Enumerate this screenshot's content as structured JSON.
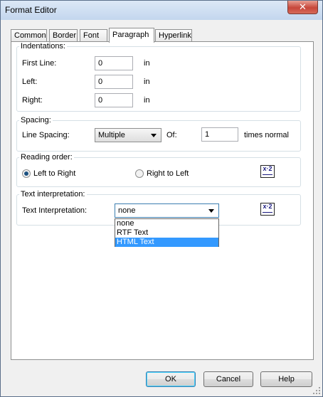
{
  "window": {
    "title": "Format Editor",
    "close_label": "✕"
  },
  "tabs": [
    {
      "label": "Common"
    },
    {
      "label": "Border"
    },
    {
      "label": "Font"
    },
    {
      "label": "Paragraph",
      "active": true
    },
    {
      "label": "Hyperlink"
    }
  ],
  "indentations": {
    "legend": "Indentations:",
    "first_line": {
      "label": "First Line:",
      "value": "0",
      "unit": "in"
    },
    "left": {
      "label": "Left:",
      "value": "0",
      "unit": "in"
    },
    "right": {
      "label": "Right:",
      "value": "0",
      "unit": "in"
    }
  },
  "spacing": {
    "legend": "Spacing:",
    "line_spacing_label": "Line Spacing:",
    "line_spacing_value": "Multiple",
    "of_label": "Of:",
    "of_value": "1",
    "of_unit": "times normal"
  },
  "reading_order": {
    "legend": "Reading order:",
    "ltr_label": "Left to Right",
    "rtl_label": "Right to Left",
    "selected": "Left to Right"
  },
  "text_interpretation": {
    "legend": "Text interpretation:",
    "label": "Text Interpretation:",
    "value": "none",
    "options": [
      "none",
      "RTF Text",
      "HTML Text"
    ],
    "highlighted": "HTML Text"
  },
  "formula_icon": "x-2-formula-icon",
  "buttons": {
    "ok": "OK",
    "cancel": "Cancel",
    "help": "Help"
  }
}
